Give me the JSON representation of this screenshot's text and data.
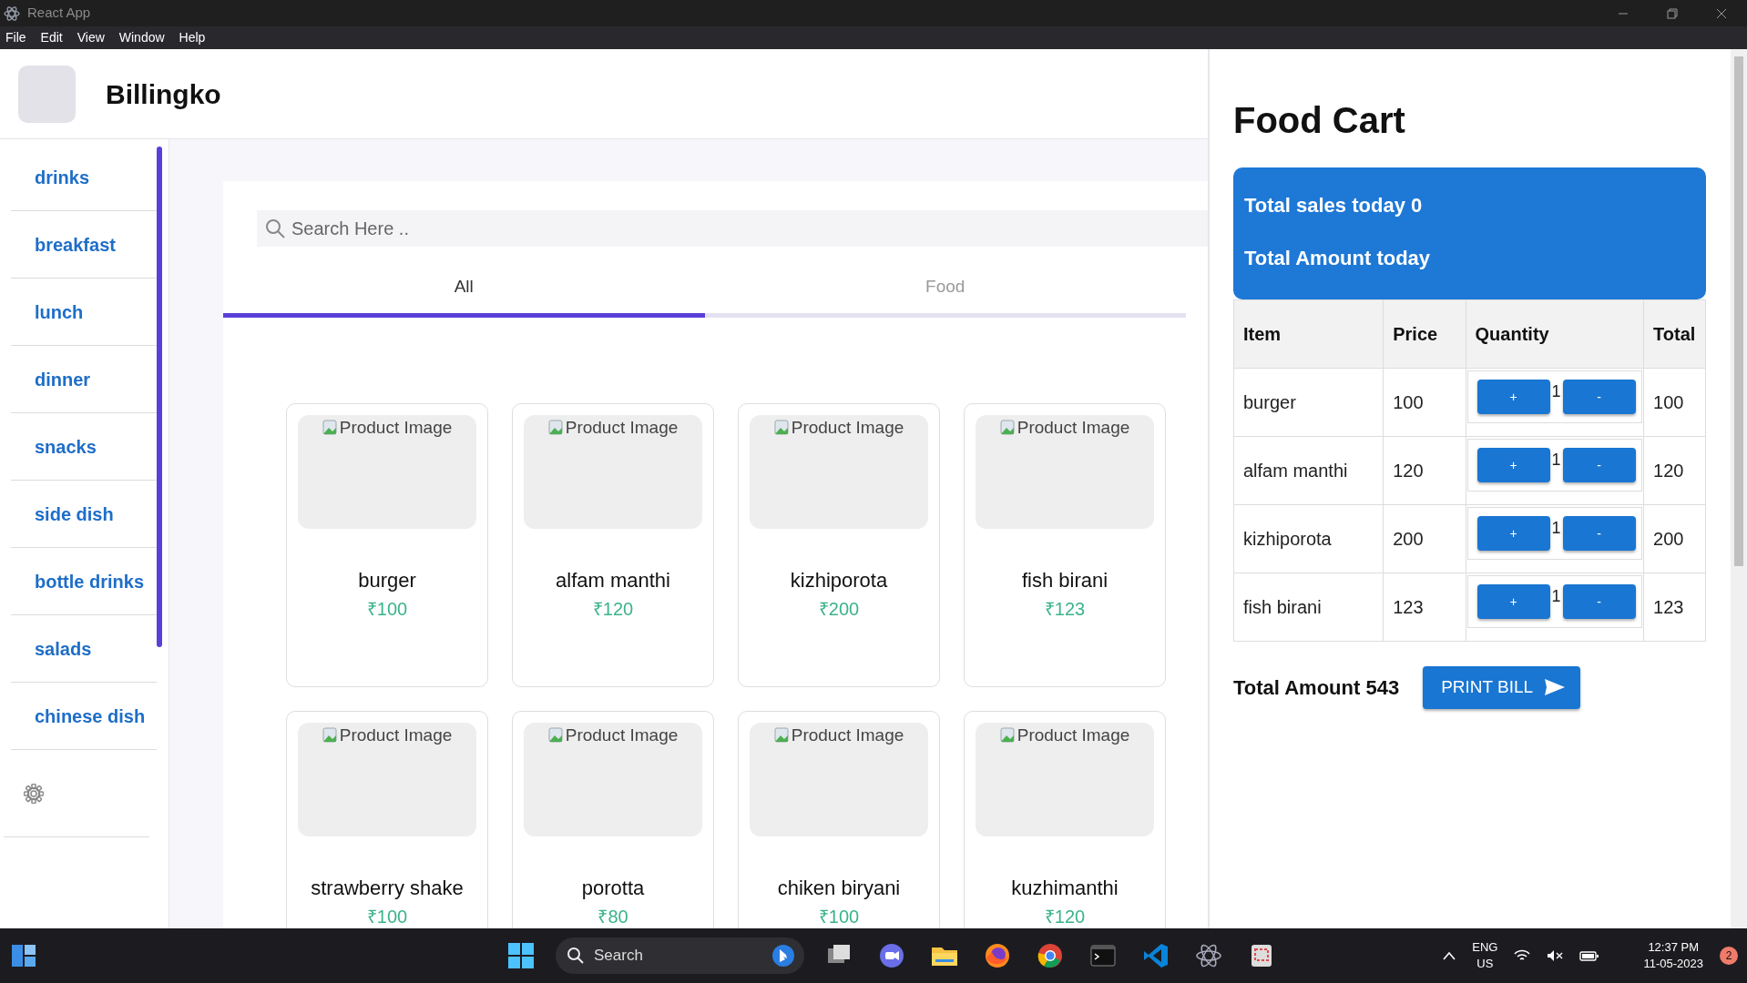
{
  "window": {
    "title": "React App"
  },
  "menu": [
    "File",
    "Edit",
    "View",
    "Window",
    "Help"
  ],
  "app": {
    "name": "Billingko"
  },
  "categories": [
    "drinks",
    "breakfast",
    "lunch",
    "dinner",
    "snacks",
    "side dish",
    "bottle drinks",
    "salads",
    "chinese dish"
  ],
  "search": {
    "placeholder": "Search Here .."
  },
  "tabs": [
    {
      "label": "All",
      "selected": true
    },
    {
      "label": "Food",
      "selected": false
    }
  ],
  "products": [
    {
      "image_alt": "Product Image",
      "name": "burger",
      "price": "₹100"
    },
    {
      "image_alt": "Product Image",
      "name": "alfam manthi",
      "price": "₹120"
    },
    {
      "image_alt": "Product Image",
      "name": "kizhiporota",
      "price": "₹200"
    },
    {
      "image_alt": "Product Image",
      "name": "fish birani",
      "price": "₹123"
    },
    {
      "image_alt": "Product Image",
      "name": "strawberry shake",
      "price": "₹100"
    },
    {
      "image_alt": "Product Image",
      "name": "porotta",
      "price": "₹80"
    },
    {
      "image_alt": "Product Image",
      "name": "chiken biryani",
      "price": "₹100"
    },
    {
      "image_alt": "Product Image",
      "name": "kuzhimanthi",
      "price": "₹120"
    }
  ],
  "cart": {
    "title": "Food Cart",
    "summary": [
      "Total sales today 0",
      "Total Amount today"
    ],
    "columns": [
      "Item",
      "Price",
      "Quantity",
      "Total"
    ],
    "rows": [
      {
        "item": "burger",
        "price": "100",
        "plus": "+",
        "quantity": "1",
        "minus": "-",
        "total": "100"
      },
      {
        "item": "alfam manthi",
        "price": "120",
        "plus": "+",
        "quantity": "1",
        "minus": "-",
        "total": "120"
      },
      {
        "item": "kizhiporota",
        "price": "200",
        "plus": "+",
        "quantity": "1",
        "minus": "-",
        "total": "200"
      },
      {
        "item": "fish birani",
        "price": "123",
        "plus": "+",
        "quantity": "1",
        "minus": "-",
        "total": "123"
      }
    ],
    "total_amount": "Total Amount 543",
    "print_button": "PRINT BILL"
  },
  "taskbar": {
    "search": "Search",
    "language": "ENG",
    "region": "US",
    "time": "12:37 PM",
    "date": "11-05-2023",
    "notifications": "2"
  }
}
